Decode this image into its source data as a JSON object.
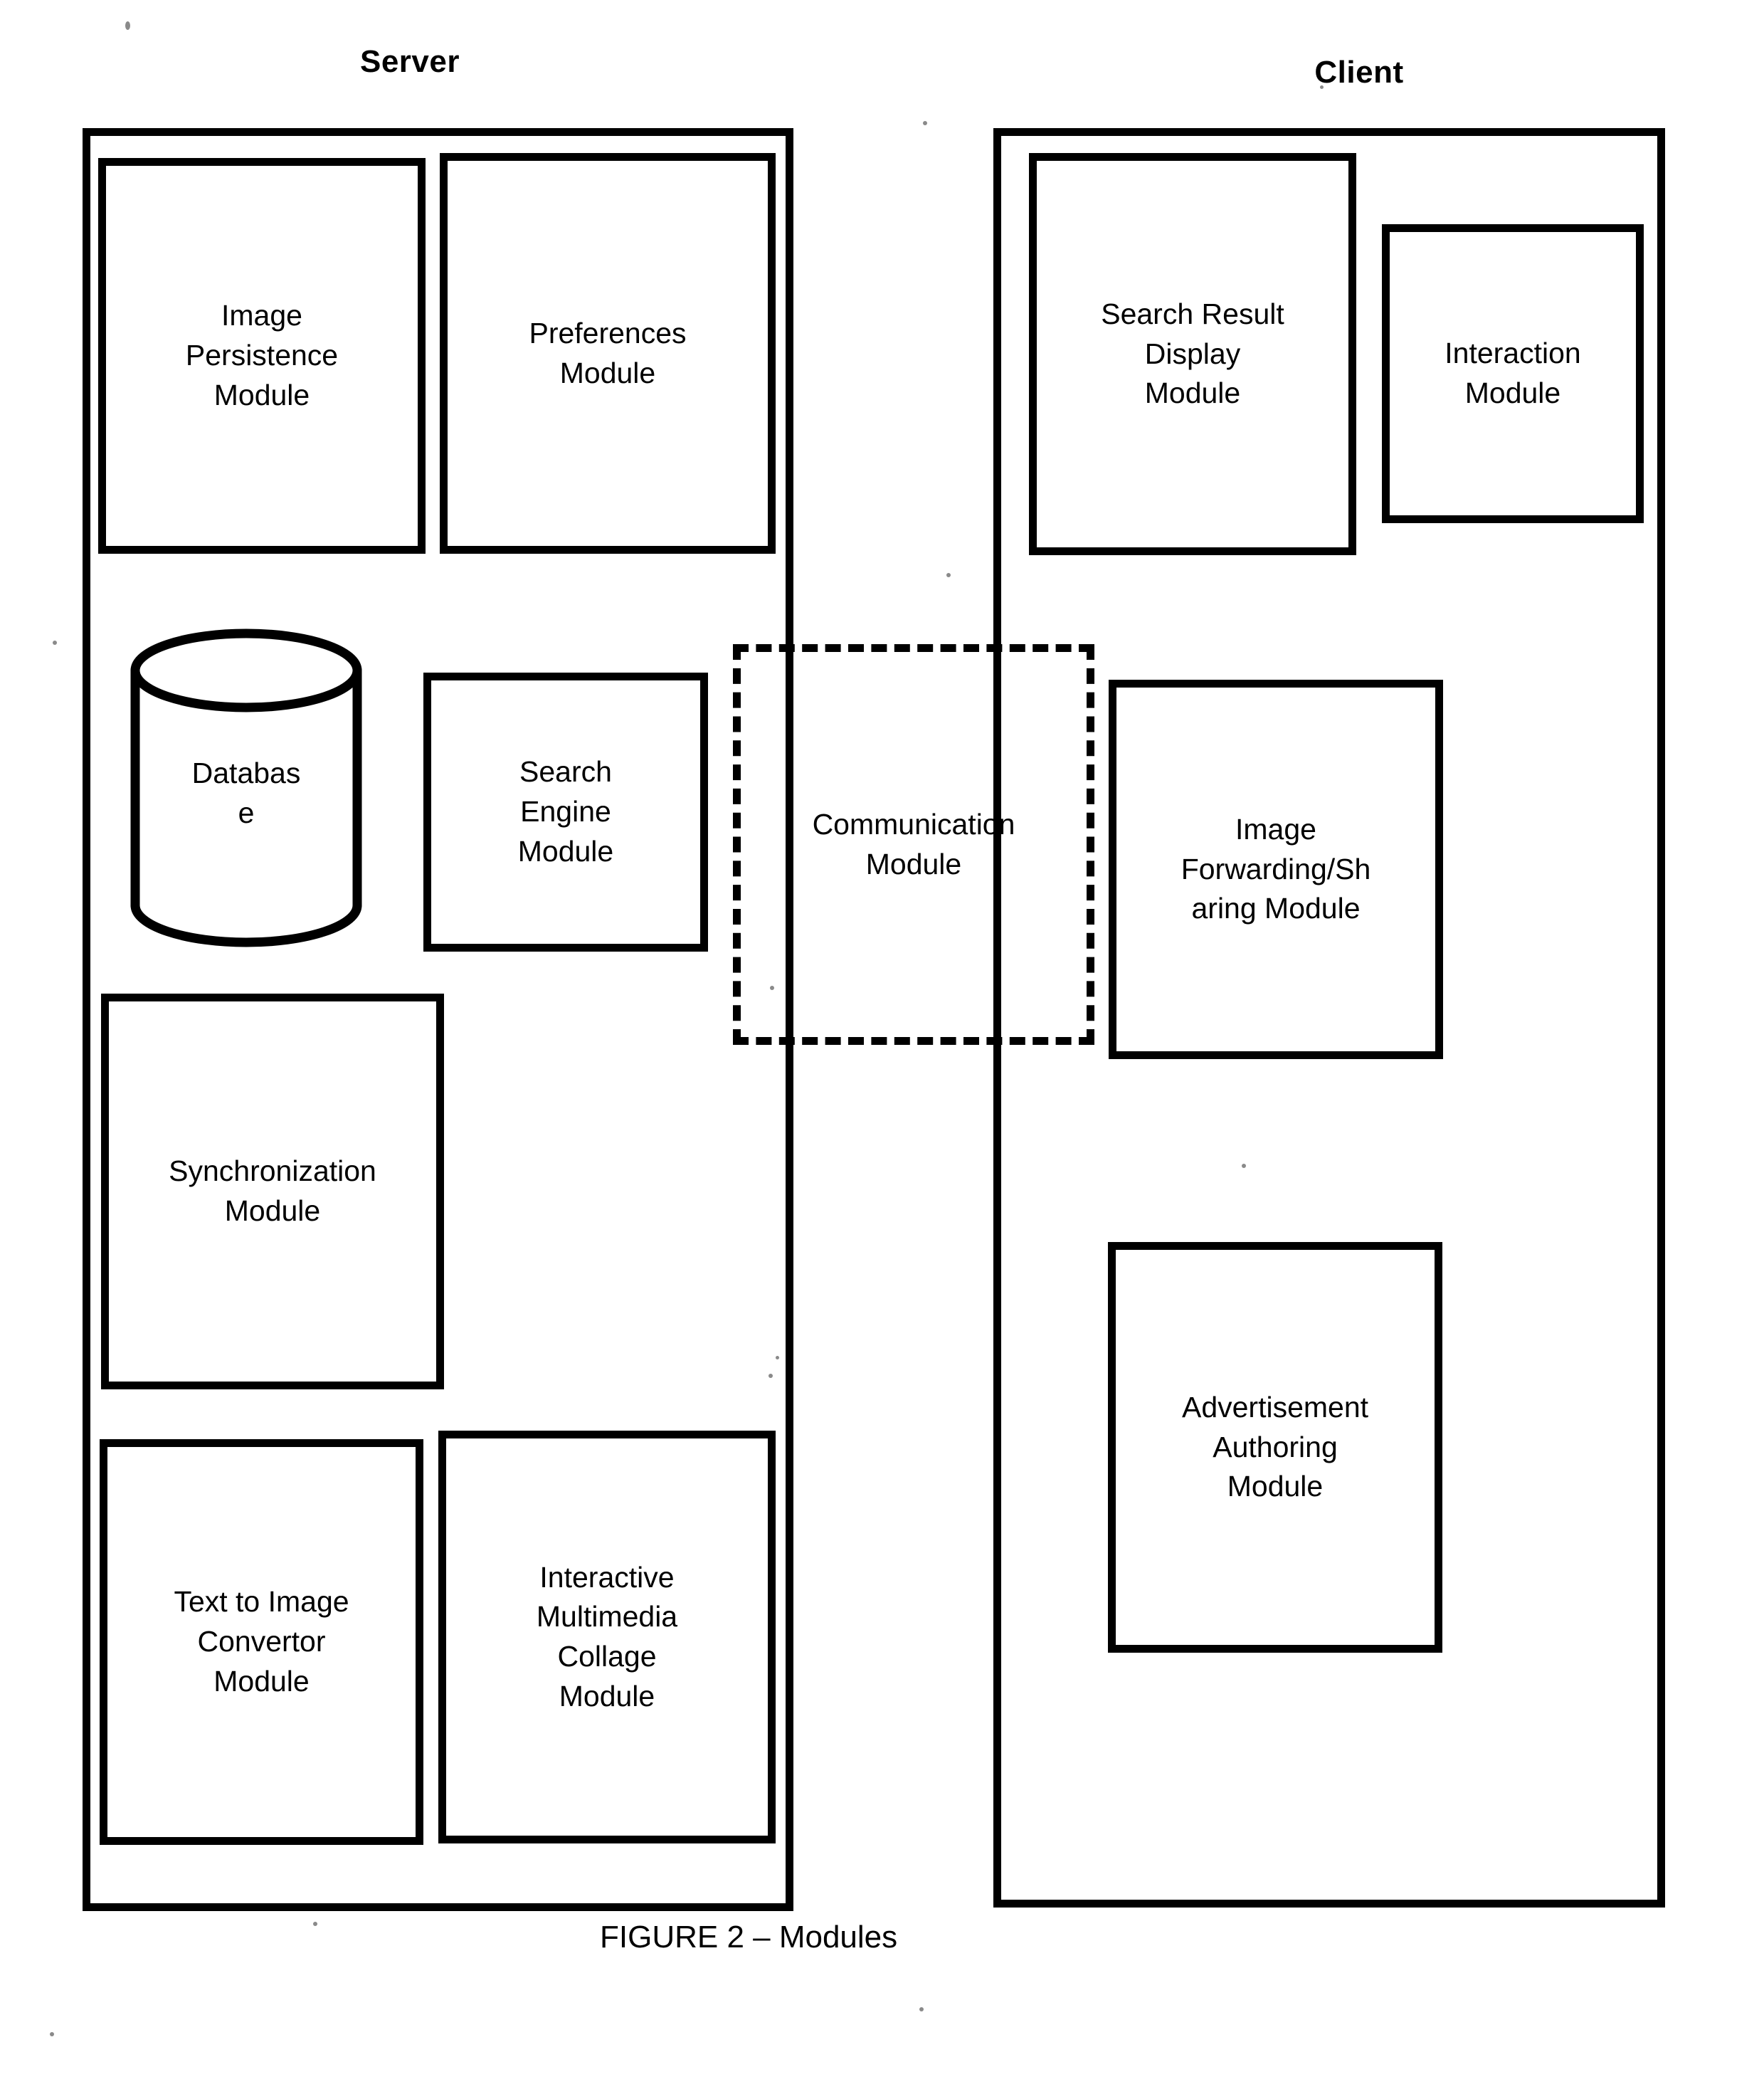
{
  "figure": {
    "caption": "FIGURE 2 – Modules"
  },
  "groups": {
    "server": {
      "title": "Server",
      "modules": [
        {
          "id": "image-persistence-module",
          "label": "Image\nPersistence\nModule"
        },
        {
          "id": "preferences-module",
          "label": "Preferences\nModule"
        },
        {
          "id": "database",
          "label": "Databas\ne",
          "shape": "cylinder"
        },
        {
          "id": "search-engine-module",
          "label": "Search\nEngine\nModule"
        },
        {
          "id": "synchronization-module",
          "label": "Synchronization\nModule"
        },
        {
          "id": "text-to-image-convertor-module",
          "label": "Text to Image\nConvertor\nModule"
        },
        {
          "id": "interactive-multimedia-collage-module",
          "label": "Interactive\nMultimedia\nCollage\nModule"
        }
      ]
    },
    "client": {
      "title": "Client",
      "modules": [
        {
          "id": "search-result-display-module",
          "label": "Search Result\nDisplay\nModule"
        },
        {
          "id": "interaction-module",
          "label": "Interaction\nModule"
        },
        {
          "id": "image-forwarding-sharing-module",
          "label": "Image\nForwarding/Sh\naring Module"
        },
        {
          "id": "advertisement-authoring-module",
          "label": "Advertisement\nAuthoring\nModule"
        }
      ]
    },
    "shared": {
      "modules": [
        {
          "id": "communication-module",
          "label": "Communication\nModule",
          "style": "dashed"
        }
      ]
    }
  },
  "colors": {
    "stroke": "#000000",
    "background": "#ffffff",
    "text": "#000000"
  }
}
